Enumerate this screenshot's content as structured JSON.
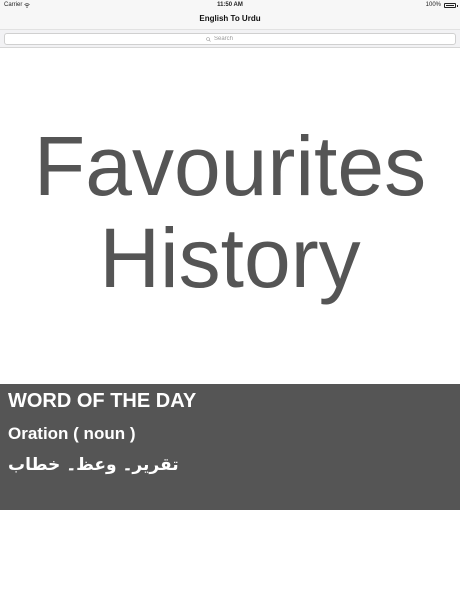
{
  "status_bar": {
    "carrier": "Carrier",
    "time": "11:50 AM",
    "battery": "100%"
  },
  "nav": {
    "title": "English To Urdu"
  },
  "search": {
    "placeholder": "Search"
  },
  "menu": {
    "favourites_label": "Favourites",
    "history_label": "History"
  },
  "word_of_the_day": {
    "heading": "WORD OF THE DAY",
    "word": "Oration ( noun )",
    "translation": "تقریر۔ وعظ۔ خطاب"
  },
  "colors": {
    "menu_text": "#555555",
    "wotd_background": "#555555",
    "wotd_text": "#ffffff"
  }
}
